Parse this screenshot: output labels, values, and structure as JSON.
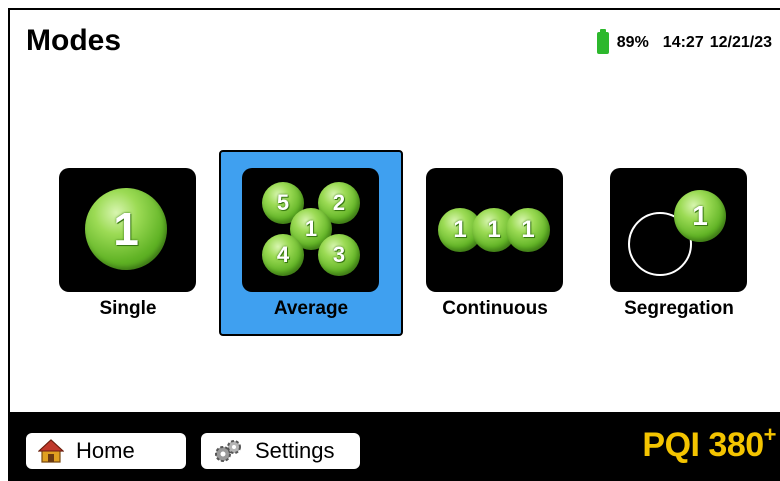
{
  "header": {
    "title": "Modes",
    "battery_percent": "89%",
    "time": "14:27",
    "date": "12/21/23",
    "battery_color": "#2db82d"
  },
  "modes": [
    {
      "label": "Single",
      "selected": false,
      "icon": "single-mode-icon",
      "coins": [
        "1"
      ]
    },
    {
      "label": "Average",
      "selected": true,
      "icon": "average-mode-icon",
      "coins": [
        "5",
        "2",
        "1",
        "4",
        "3"
      ]
    },
    {
      "label": "Continuous",
      "selected": false,
      "icon": "continuous-mode-icon",
      "coins": [
        "1",
        "1",
        "1"
      ]
    },
    {
      "label": "Segregation",
      "selected": false,
      "icon": "segregation-mode-icon",
      "coins": [
        "1"
      ]
    }
  ],
  "footer": {
    "home_label": "Home",
    "settings_label": "Settings",
    "brand_main": "PQI 380",
    "brand_sup": "+",
    "brand_color": "#f4c400"
  },
  "colors": {
    "selected_bg": "#3fa0f0",
    "coin_green": "#5fb224"
  }
}
